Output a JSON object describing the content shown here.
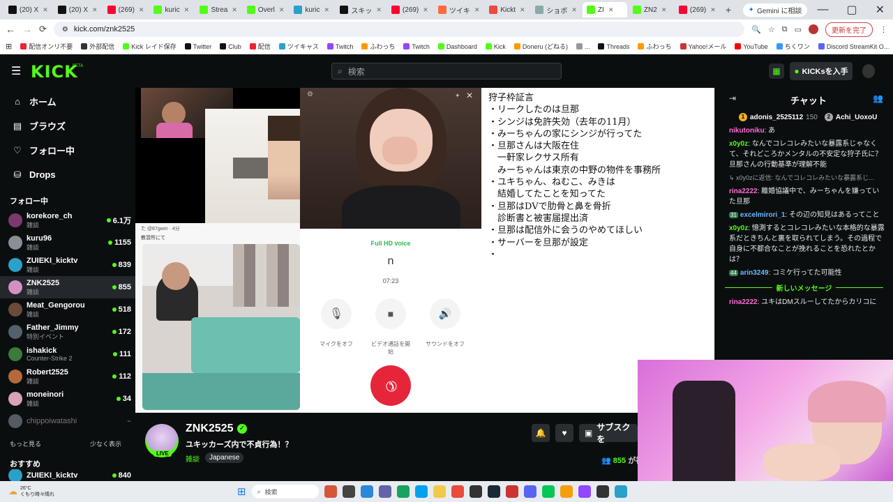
{
  "browser": {
    "tabs": [
      {
        "label": "(20) X",
        "color": "#111111"
      },
      {
        "label": "(20) X",
        "color": "#111111"
      },
      {
        "label": "(269)",
        "color": "#ff0033"
      },
      {
        "label": "kuric",
        "color": "#53fc18"
      },
      {
        "label": "Strea",
        "color": "#53fc18"
      },
      {
        "label": "Overl",
        "color": "#53fc18"
      },
      {
        "label": "kuric",
        "color": "#2aa1c9"
      },
      {
        "label": "スキッ",
        "color": "#111111"
      },
      {
        "label": "(269)",
        "color": "#ff0033"
      },
      {
        "label": "ツイキ",
        "color": "#ff6a3d"
      },
      {
        "label": "Kickt",
        "color": "#e94b3c"
      },
      {
        "label": "ショボ",
        "color": "#8aa"
      },
      {
        "label": "ZI",
        "color": "#53fc18"
      },
      {
        "label": "ZN2",
        "color": "#53fc18"
      },
      {
        "label": "(269)",
        "color": "#ff0033"
      }
    ],
    "new_tab": "+",
    "gemini_label": "Gemini に相談",
    "url": "kick.com/znk2525",
    "profile_btn": "更新を完了",
    "bookmarks": [
      "配信オンリ不要",
      "外部配信",
      "Kick レイド保存",
      "Twitter",
      "Club",
      "配信",
      "ツイキャス",
      "Twitch",
      "ふわっち",
      "Twitch",
      "Dashboard",
      "Kick",
      "Doneru (どねる)",
      "...",
      "Threads",
      "ふわっち",
      "Yahoo!メール",
      "YouTube",
      "ちくワン",
      "Discord StreamKit O...",
      "すべてのブックマーク"
    ]
  },
  "kick": {
    "logo": "KICK",
    "logo_badge": "BETA",
    "search_placeholder": "検索",
    "get_kicks": "KICKsを入手"
  },
  "sidebar": {
    "nav": [
      {
        "label": "ホーム",
        "icon": "home-icon"
      },
      {
        "label": "ブラウズ",
        "icon": "browse-icon"
      },
      {
        "label": "フォロー中",
        "icon": "heart-icon"
      },
      {
        "label": "Drops",
        "icon": "drops-icon"
      }
    ],
    "following_title": "フォロー中",
    "following": [
      {
        "name": "korekore_ch",
        "category": "雑談",
        "viewers": "6.1万",
        "color": "#7b3a6e"
      },
      {
        "name": "kuru96",
        "category": "雑談",
        "viewers": "1155",
        "color": "#8b8f94"
      },
      {
        "name": "ZUIEKI_kicktv",
        "category": "雑談",
        "viewers": "839",
        "color": "#2aa1c9"
      },
      {
        "name": "ZNK2525",
        "category": "雑談",
        "viewers": "855",
        "color": "#d68fc4"
      },
      {
        "name": "Meat_Gengorou",
        "category": "雑談",
        "viewers": "518",
        "color": "#6b4a3a"
      },
      {
        "name": "Father_Jimmy",
        "category": "特別イベント",
        "viewers": "172",
        "color": "#54606b"
      },
      {
        "name": "ishakick",
        "category": "Counter-Strike 2",
        "viewers": "111",
        "color": "#3a7a3a"
      },
      {
        "name": "Robert2525",
        "category": "雑談",
        "viewers": "112",
        "color": "#b5683a"
      },
      {
        "name": "moneinori",
        "category": "雑談",
        "viewers": "34",
        "color": "#d8a2b8"
      },
      {
        "name": "chippoiwatashi",
        "category": "",
        "viewers": "",
        "color": "#555b60"
      }
    ],
    "show_more": "もっと見る",
    "show_less": "少なく表示",
    "recommended_title": "おすすめ",
    "recommended_first": "ZUIEKI_kicktv",
    "recommended_first_viewers": "840"
  },
  "video": {
    "tweet_handle": "た @87gwm · 4分",
    "tweet_text": "教習所にて",
    "call": {
      "quality": "Full HD voice",
      "name": "n",
      "duration": "07:23",
      "mic_label": "マイクをオフ",
      "video_label": "ビデオ通話を開始",
      "sound_label": "サウンドをオフ"
    },
    "notes": [
      "狩子枠証言",
      "・リークしたのは旦那",
      "・シンジは免許失効（去年の11月）",
      "・みーちゃんの家にシンジが行ってた",
      "・旦那さんは大阪在住",
      "　一軒家レクサス所有",
      "　みーちゃんは東京の中野の物件を事務所",
      "・ユキちゃん、ねむこ、みきは",
      "　結婚してたことを知ってた",
      "・旦那はDVで肋骨と鼻を骨折",
      "　診断書と被害届提出済",
      "・旦那は配信外に会うのやめてほしい",
      "・サーバーを旦那が設定",
      "・"
    ]
  },
  "stream": {
    "channel": "ZNK2525",
    "title": "ユキッカーズ内で不貞行為！？",
    "category": "雑談",
    "language": "Japanese",
    "live_badge": "LIVE",
    "subscribe_label": "サブスクを",
    "viewers": "855",
    "viewers_suffix": "が視"
  },
  "chat": {
    "title": "チャット",
    "gifters": [
      {
        "name": "adonis_2525112",
        "count": "150",
        "rank": "1"
      },
      {
        "name": "Achi_UoxoU",
        "count": "",
        "rank": "2"
      }
    ],
    "messages": [
      {
        "user": "nikutoniku",
        "color": "#ff6bd6",
        "text": "あ",
        "badge": ""
      },
      {
        "user": "x0y0z",
        "color": "#53fc18",
        "text": "なんでコレコレみたいな暴露系じゃなくて、それどころかメンタルの不安定な狩子氏に？旦那さんの行動基準が理解不能",
        "badge": ""
      },
      {
        "user": "",
        "color": "#9aa0a6",
        "text": "↳ x0y0zに返信: なんでコレコレみたいな暴露系じ...",
        "badge": ""
      },
      {
        "user": "rina2222",
        "color": "#ff6bd6",
        "text": "離婚協議中で、みーちゃんを嫌っていた旦那",
        "badge": ""
      },
      {
        "user": "excelmirori_1",
        "color": "#6bb8ff",
        "text": "その辺の知見はあるってこと",
        "badge": "31"
      },
      {
        "user": "x0y0z",
        "color": "#53fc18",
        "text": "憶測するとコレコレみたいな本格的な暴露系だときちんと裏を取られてしまう。その過程で自身に不都合なことが挽れることを恐れたとかは？",
        "badge": ""
      },
      {
        "user": "arin3249",
        "color": "#6bb8ff",
        "text": "コミケ行ってた可能性",
        "badge": "44"
      }
    ],
    "new_messages_label": "新しいメッセージ",
    "after_messages": [
      {
        "user": "rina2222",
        "color": "#ff6bd6",
        "text": "ユキはDMスルーしてたからカリコに"
      }
    ]
  },
  "taskbar": {
    "weather_temp": "26°C",
    "weather_desc": "くもり時々晴れ",
    "search_placeholder": "検索"
  }
}
